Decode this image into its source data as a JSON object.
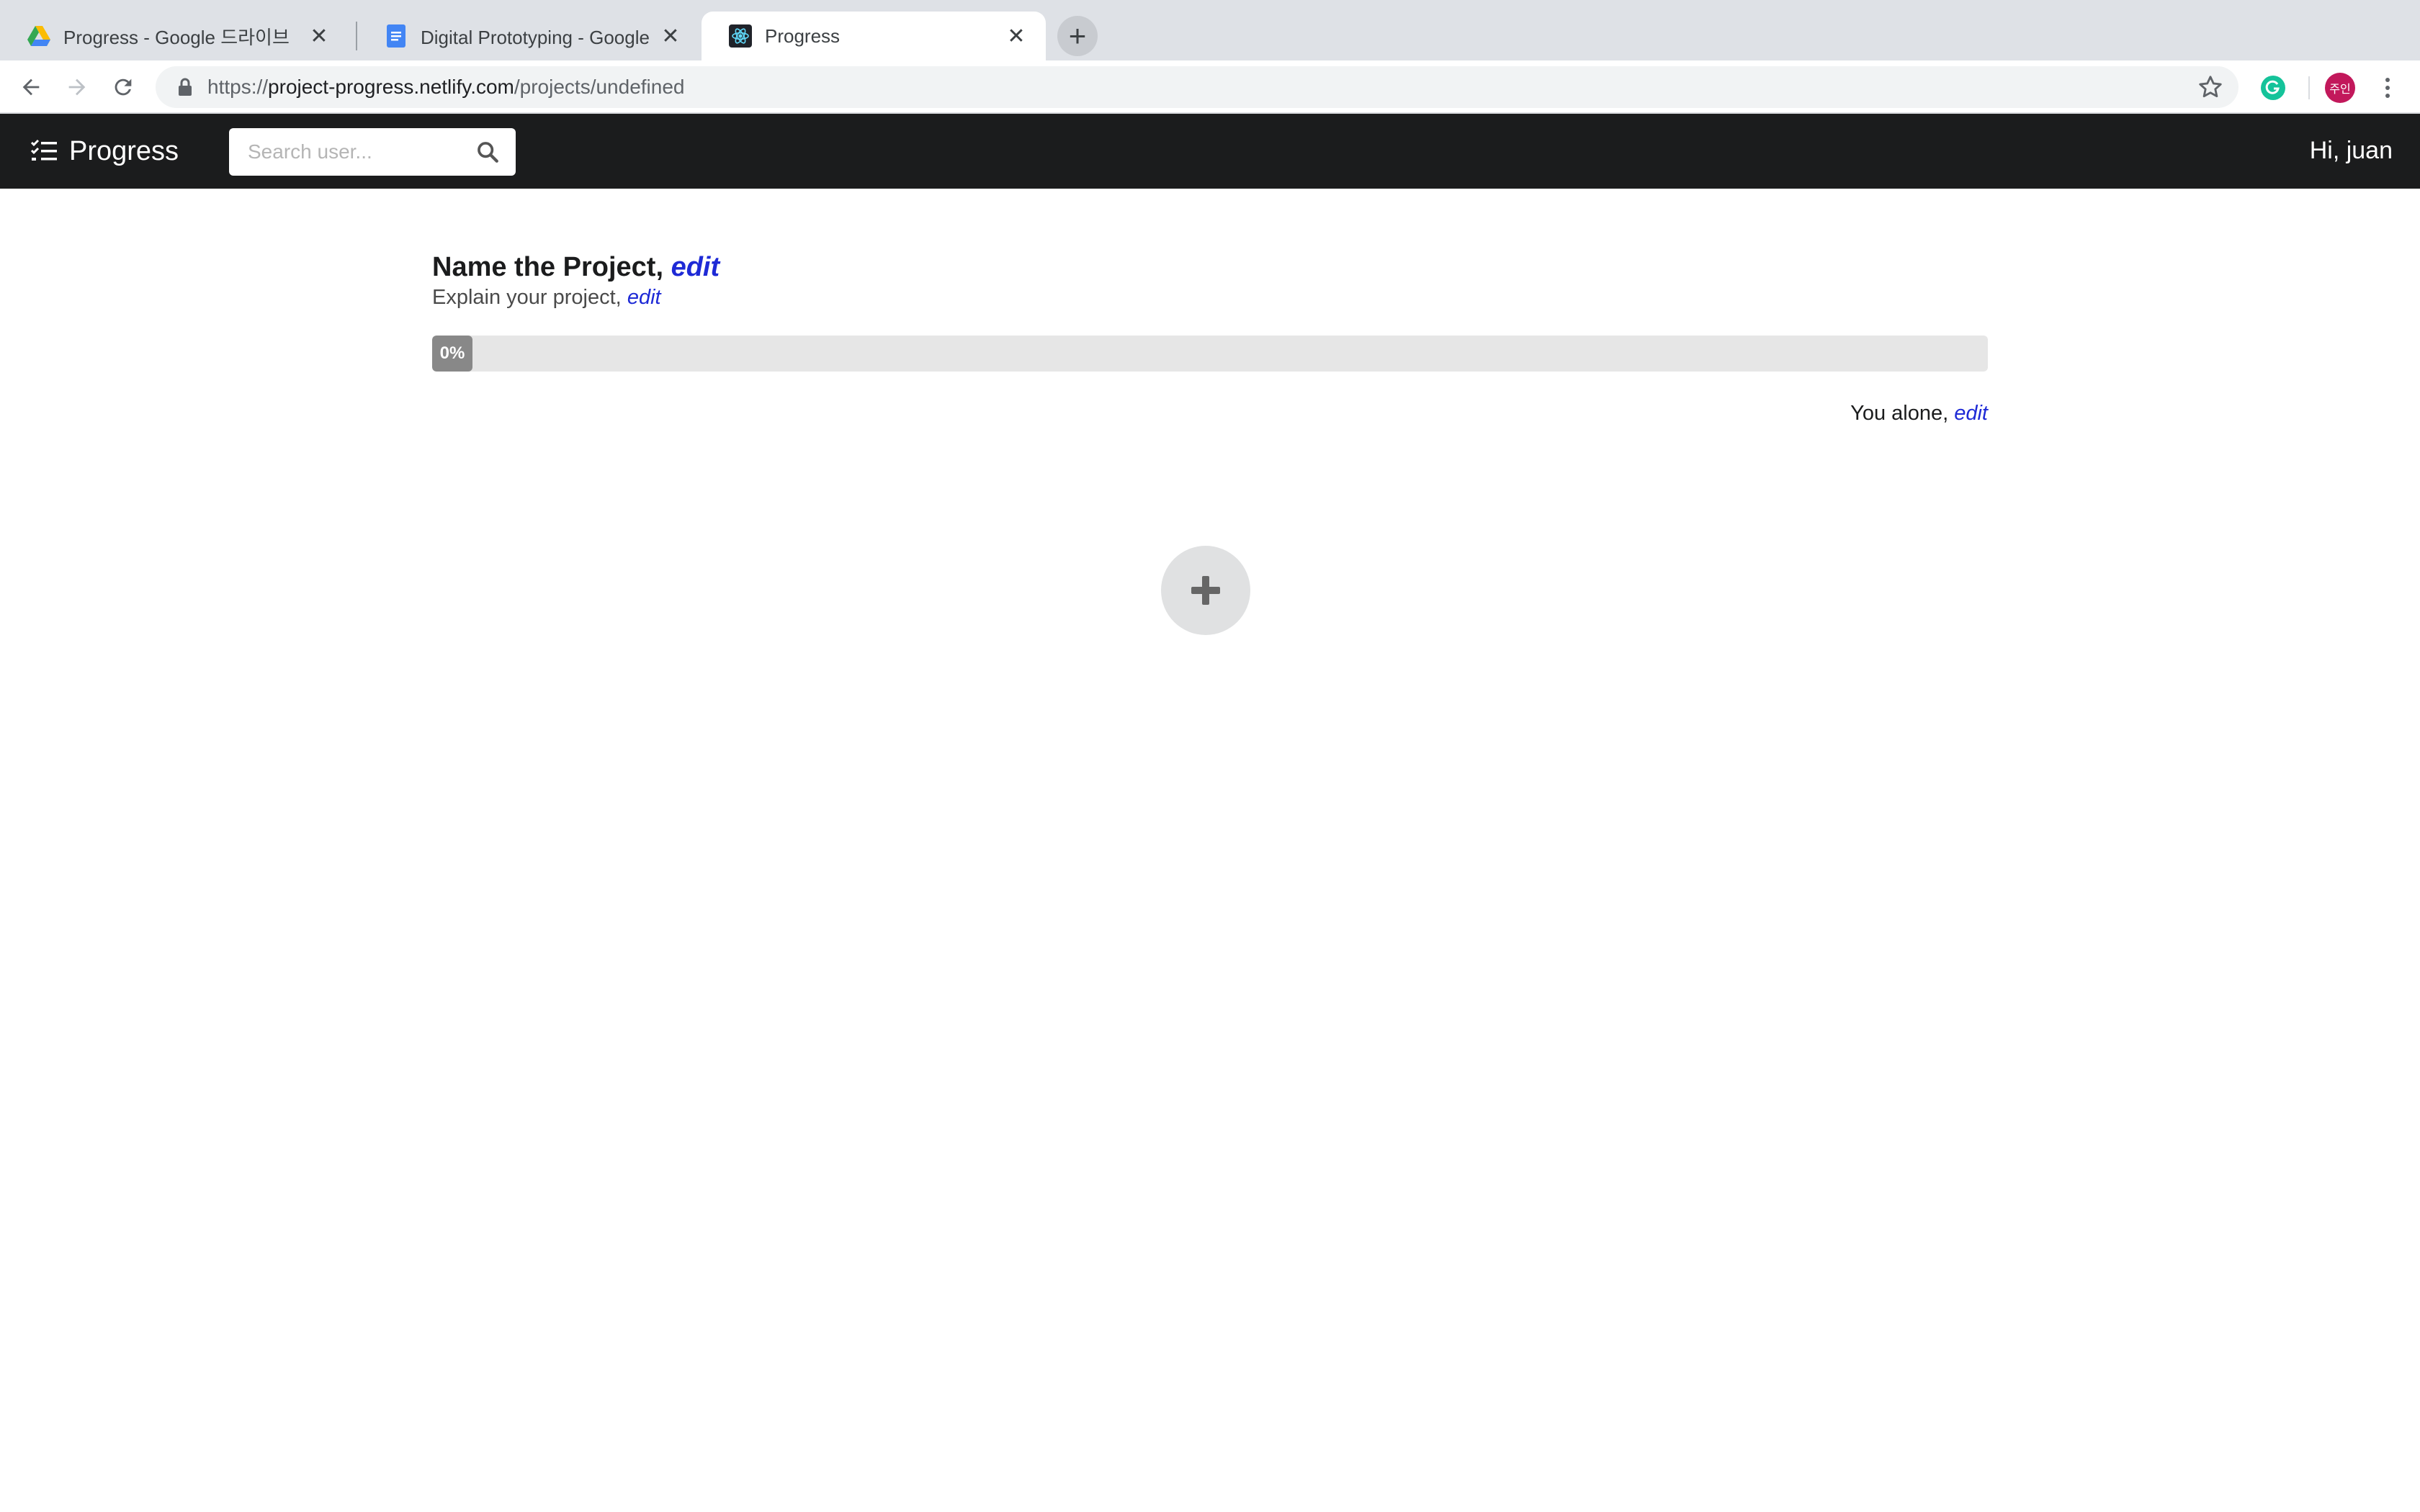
{
  "browser": {
    "tabs": [
      {
        "title": "Progress - Google 드라이브",
        "icon": "google-drive-icon"
      },
      {
        "title": "Digital Prototyping - Google 문서",
        "icon": "google-docs-icon"
      },
      {
        "title": "Progress",
        "icon": "react-icon"
      }
    ],
    "url": {
      "scheme": "https://",
      "host": "project-progress.netlify.com",
      "path": "/projects/undefined"
    },
    "profile_initials": "주인"
  },
  "app": {
    "brand": "Progress",
    "search_placeholder": "Search user...",
    "greeting": "Hi, juan"
  },
  "project": {
    "title": "Name the Project,",
    "title_edit": "edit",
    "description": "Explain your project,",
    "description_edit": "edit",
    "progress": 0,
    "progress_label": "0%",
    "members": "You alone,",
    "members_edit": "edit"
  },
  "colors": {
    "appbar": "#1b1c1d",
    "edit_link": "#1e2ad6",
    "progress_fill": "#888888",
    "progress_track": "#e6e6e6",
    "add_button": "#e0e1e2"
  }
}
